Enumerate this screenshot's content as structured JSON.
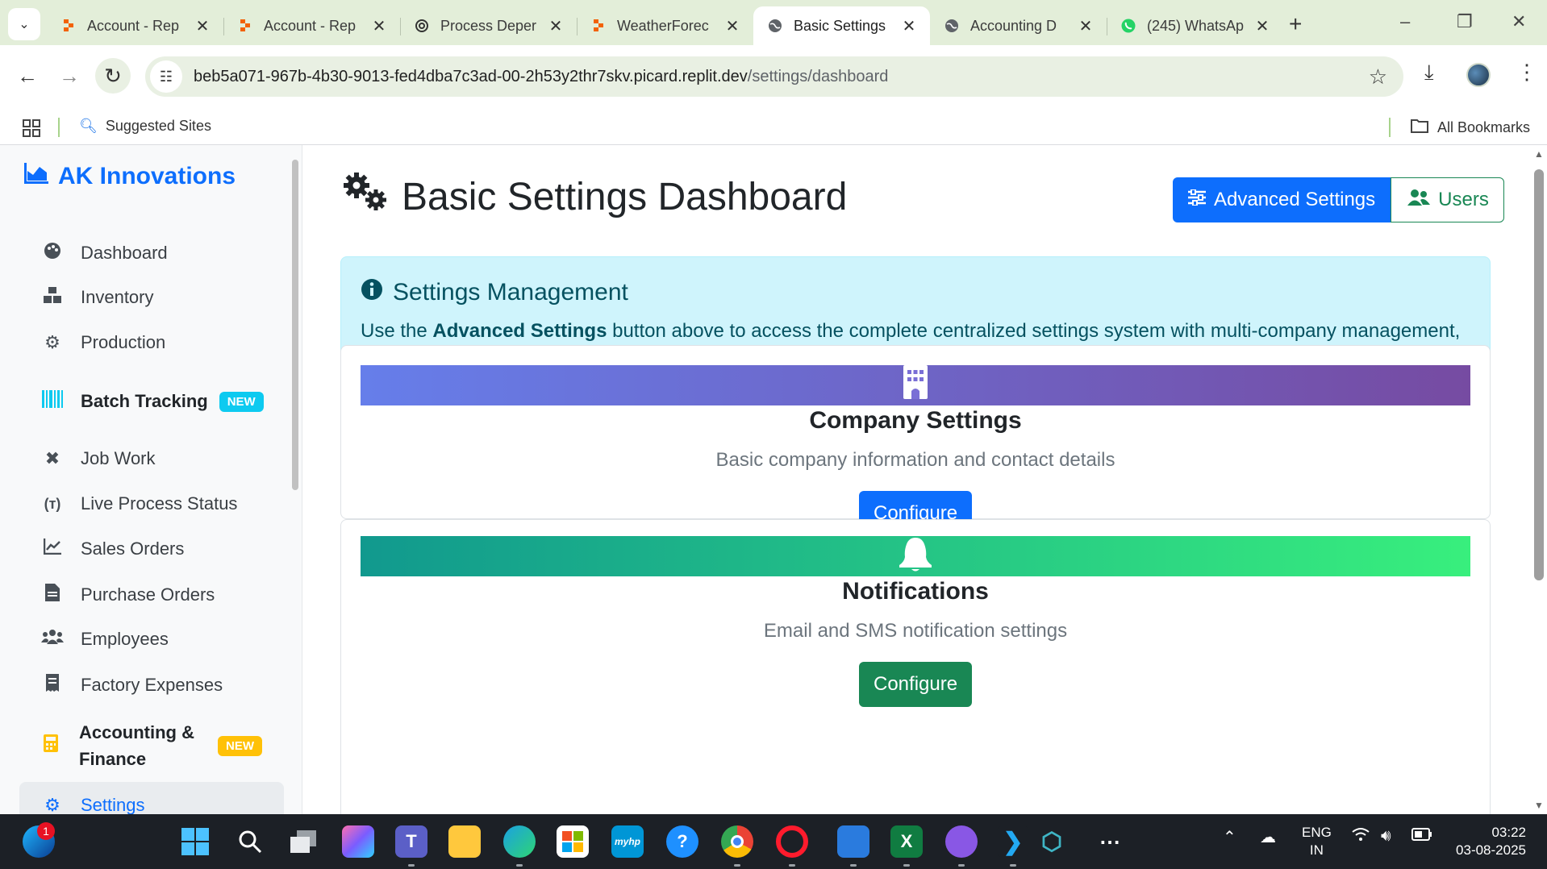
{
  "browser": {
    "tabs": [
      {
        "title": "Account - Rep",
        "icon": "replit-icon"
      },
      {
        "title": "Account - Rep",
        "icon": "replit-icon"
      },
      {
        "title": "Process Deper",
        "icon": "openai-icon"
      },
      {
        "title": "WeatherForec",
        "icon": "replit-icon"
      },
      {
        "title": "Basic Settings",
        "icon": "globe-icon",
        "active": true
      },
      {
        "title": "Accounting D",
        "icon": "globe-icon"
      },
      {
        "title": "(245) WhatsAp",
        "icon": "whatsapp-icon"
      }
    ],
    "url_host": "beb5a071-967b-4b30-9013-fed4dba7c3ad-00-2h53y2thr7skv.picard.replit.dev",
    "url_path": "/settings/dashboard",
    "bookmarks": {
      "suggested": "Suggested Sites",
      "all": "All Bookmarks"
    }
  },
  "sidebar": {
    "brand": "AK Innovations",
    "items": [
      {
        "label": "Dashboard",
        "icon": "palette-icon"
      },
      {
        "label": "Inventory",
        "icon": "boxes-icon"
      },
      {
        "label": "Production",
        "icon": "cogs-icon"
      },
      {
        "label": "Batch Tracking",
        "icon": "barcode-icon",
        "badge": "NEW"
      },
      {
        "label": "Job Work",
        "icon": "tools-icon"
      },
      {
        "label": "Live Process Status",
        "icon": "broadcast-icon"
      },
      {
        "label": "Sales Orders",
        "icon": "chart-line-icon"
      },
      {
        "label": "Purchase Orders",
        "icon": "file-invoice-icon"
      },
      {
        "label": "Employees",
        "icon": "users-icon"
      },
      {
        "label": "Factory Expenses",
        "icon": "receipt-icon"
      },
      {
        "label": "Accounting & Finance",
        "icon": "calculator-icon",
        "badge": "NEW"
      },
      {
        "label": "Settings",
        "icon": "gear-icon",
        "active": true
      }
    ]
  },
  "main": {
    "title": "Basic Settings Dashboard",
    "advanced_button": "Advanced Settings",
    "users_button": "Users",
    "alert": {
      "heading": "Settings Management",
      "text_prefix": "Use the ",
      "text_bold": "Advanced Settings",
      "text_suffix": " button above to access the complete centralized settings system with multi-company management, inventory configuration, accounting rules, and production controls."
    },
    "cards": [
      {
        "title": "Company Settings",
        "text": "Basic company information and contact details",
        "button": "Configure",
        "icon": "building-icon",
        "color": "#0d6efd"
      },
      {
        "title": "Notifications",
        "text": "Email and SMS notification settings",
        "button": "Configure",
        "icon": "bell-icon",
        "color": "#198754"
      }
    ]
  },
  "taskbar": {
    "notification_count": "1",
    "lang": "ENG",
    "region": "IN",
    "time": "03:22",
    "date": "03-08-2025",
    "apps": [
      "start-icon",
      "search-icon",
      "task-view-icon",
      "copilot-icon",
      "teams-icon",
      "file-explorer-icon",
      "edge-icon",
      "store-icon",
      "myhp-icon",
      "help-icon",
      "chrome-icon",
      "opera-icon",
      "notepad-icon",
      "excel-icon",
      "github-icon",
      "vscode-icon",
      "app-icon"
    ]
  },
  "colors": {
    "primary": "#0d6efd",
    "success": "#198754",
    "info_bg": "#cff4fc",
    "badge_info": "#0dcaf0",
    "badge_warning": "#ffc107"
  }
}
